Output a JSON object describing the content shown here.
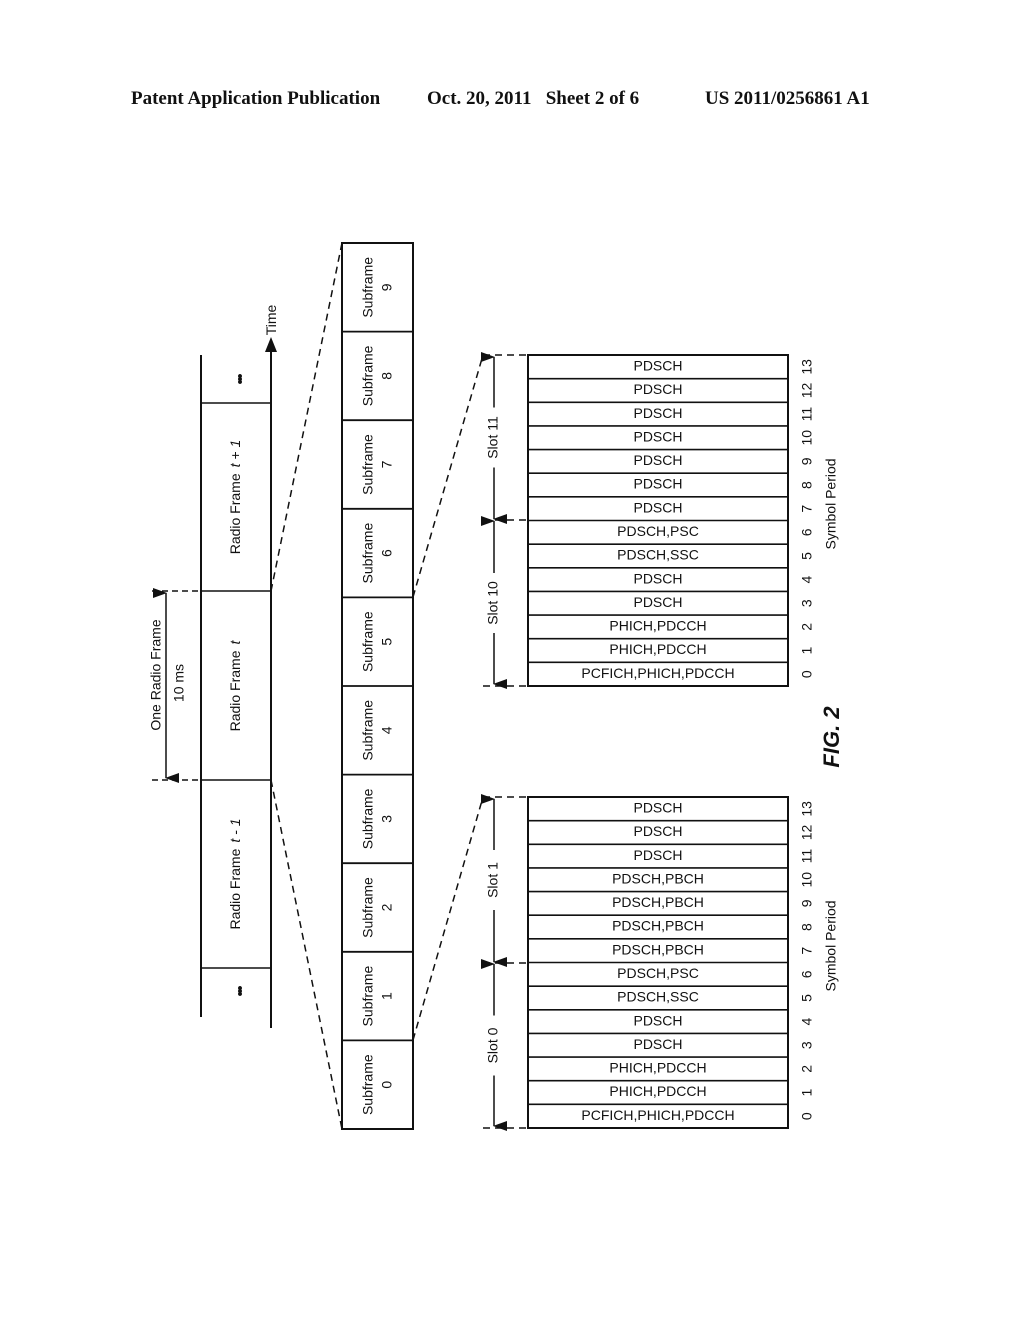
{
  "header": {
    "publication": "Patent Application Publication",
    "date_sheet": "Oct. 20, 2011   Sheet 2 of 6",
    "patent_number": "US 2011/0256861 A1"
  },
  "timeline": {
    "time_label": "Time",
    "ellipsis": "•••",
    "frames": [
      {
        "label": "Radio Frame",
        "index": "t - 1"
      },
      {
        "label": "Radio Frame",
        "index": "t"
      },
      {
        "label": "Radio Frame",
        "index": "t + 1"
      }
    ],
    "span_label_line1": "One Radio Frame",
    "span_label_line2": "10 ms"
  },
  "subframes": [
    {
      "label": "Subframe",
      "index": "0"
    },
    {
      "label": "Subframe",
      "index": "1"
    },
    {
      "label": "Subframe",
      "index": "2"
    },
    {
      "label": "Subframe",
      "index": "3"
    },
    {
      "label": "Subframe",
      "index": "4"
    },
    {
      "label": "Subframe",
      "index": "5"
    },
    {
      "label": "Subframe",
      "index": "6"
    },
    {
      "label": "Subframe",
      "index": "7"
    },
    {
      "label": "Subframe",
      "index": "8"
    },
    {
      "label": "Subframe",
      "index": "9"
    }
  ],
  "tables": [
    {
      "name": "subframe-0-symbols",
      "slot_low": "Slot 0",
      "slot_high": "Slot 1",
      "axis_label": "Symbol Period",
      "symbols": [
        {
          "period": "0",
          "channels": "PCFICH,PHICH,PDCCH"
        },
        {
          "period": "1",
          "channels": "PHICH,PDCCH"
        },
        {
          "period": "2",
          "channels": "PHICH,PDCCH"
        },
        {
          "period": "3",
          "channels": "PDSCH"
        },
        {
          "period": "4",
          "channels": "PDSCH"
        },
        {
          "period": "5",
          "channels": "PDSCH,SSC"
        },
        {
          "period": "6",
          "channels": "PDSCH,PSC"
        },
        {
          "period": "7",
          "channels": "PDSCH,PBCH"
        },
        {
          "period": "8",
          "channels": "PDSCH,PBCH"
        },
        {
          "period": "9",
          "channels": "PDSCH,PBCH"
        },
        {
          "period": "10",
          "channels": "PDSCH,PBCH"
        },
        {
          "period": "11",
          "channels": "PDSCH"
        },
        {
          "period": "12",
          "channels": "PDSCH"
        },
        {
          "period": "13",
          "channels": "PDSCH"
        }
      ]
    },
    {
      "name": "subframe-5-symbols",
      "slot_low": "Slot 10",
      "slot_high": "Slot 11",
      "axis_label": "Symbol Period",
      "symbols": [
        {
          "period": "0",
          "channels": "PCFICH,PHICH,PDCCH"
        },
        {
          "period": "1",
          "channels": "PHICH,PDCCH"
        },
        {
          "period": "2",
          "channels": "PHICH,PDCCH"
        },
        {
          "period": "3",
          "channels": "PDSCH"
        },
        {
          "period": "4",
          "channels": "PDSCH"
        },
        {
          "period": "5",
          "channels": "PDSCH,SSC"
        },
        {
          "period": "6",
          "channels": "PDSCH,PSC"
        },
        {
          "period": "7",
          "channels": "PDSCH"
        },
        {
          "period": "8",
          "channels": "PDSCH"
        },
        {
          "period": "9",
          "channels": "PDSCH"
        },
        {
          "period": "10",
          "channels": "PDSCH"
        },
        {
          "period": "11",
          "channels": "PDSCH"
        },
        {
          "period": "12",
          "channels": "PDSCH"
        },
        {
          "period": "13",
          "channels": "PDSCH"
        }
      ]
    }
  ],
  "figure_label": "FIG. 2"
}
